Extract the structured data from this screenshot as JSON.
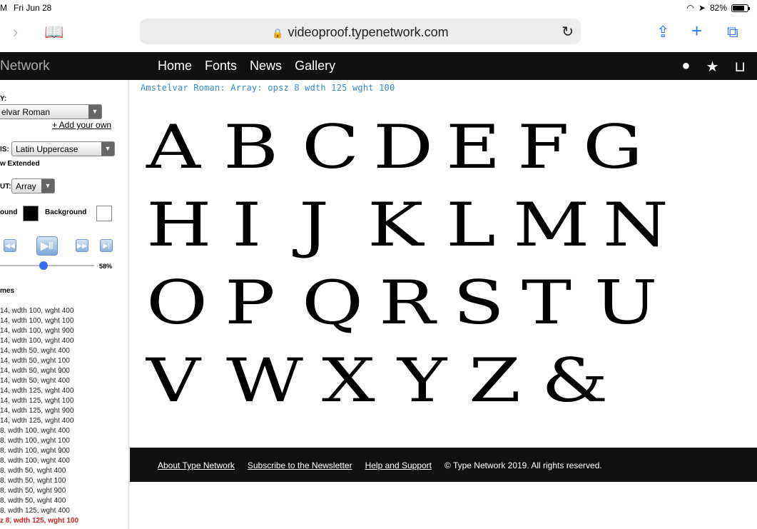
{
  "status": {
    "time": "M",
    "date": "Fri Jun 28",
    "battery": "82%",
    "battery_fill": 0.82
  },
  "browser": {
    "url": "videoproof.typenetwork.com"
  },
  "header": {
    "brand": "Network",
    "nav": [
      "Home",
      "Fonts",
      "News",
      "Gallery"
    ]
  },
  "sidebar": {
    "family_label": "Y:",
    "family_value": "elvar Roman",
    "add_link": "+ Add your own",
    "glyphs_label": "IS:",
    "glyphs_value": "Latin Uppercase",
    "extended": "w Extended",
    "layout_label": "UT:",
    "layout_value": "Array",
    "foreground_label": "ound",
    "background_label": "Background",
    "foreground_color": "#000000",
    "background_color": "#ffffff",
    "progress_label": "58%",
    "progress": 0.58,
    "frames_label": "mes",
    "frames": [
      " 14, wdth 100, wght 400",
      " 14, wdth 100, wght 100",
      " 14, wdth 100, wght 900",
      " 14, wdth 100, wght 400",
      " 14, wdth 50, wght 400",
      " 14, wdth 50, wght 100",
      " 14, wdth 50, wght 900",
      " 14, wdth 50, wght 400",
      " 14, wdth 125, wght 400",
      " 14, wdth 125, wght 100",
      " 14, wdth 125, wght 900",
      " 14, wdth 125, wght 400",
      " 8, wdth 100, wght 400",
      " 8, wdth 100, wght 100",
      " 8, wdth 100, wght 900",
      " 8, wdth 100, wght 400",
      " 8, wdth 50, wght 400",
      " 8, wdth 50, wght 100",
      " 8, wdth 50, wght 900",
      " 8, wdth 50, wght 400",
      " 8, wdth 125, wght 400",
      "z 8, wdth 125, wght 100"
    ],
    "active_frame_index": 21
  },
  "main": {
    "caption": "Amstelvar Roman: Array: opsz 8 wdth 125 wght 100",
    "rows": [
      [
        "A",
        "B",
        "C",
        "D",
        "E",
        "F",
        "G"
      ],
      [
        "H",
        "I",
        "J",
        "K",
        "L",
        "M",
        "N"
      ],
      [
        "O",
        "P",
        "Q",
        "R",
        "S",
        "T",
        "U"
      ],
      [
        "V",
        "W",
        "X",
        "Y",
        "Z",
        "&"
      ]
    ]
  },
  "footer": {
    "links": [
      "About Type Network",
      "Subscribe to the Newsletter",
      "Help and Support"
    ],
    "copyright": "© Type Network 2019. All rights reserved."
  }
}
